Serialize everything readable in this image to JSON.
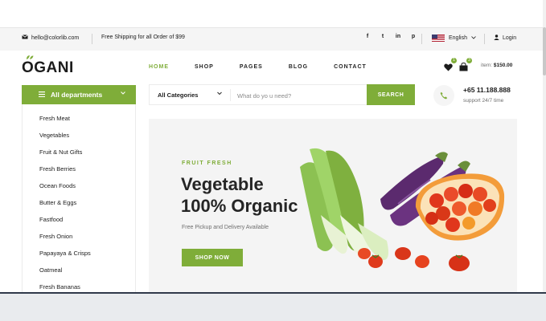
{
  "header_top": {
    "email": "hello@colorlib.com",
    "shipping": "Free Shipping for all Order of $99",
    "socials": [
      "f",
      "t",
      "in",
      "p"
    ],
    "language": "English",
    "login": "Login"
  },
  "logo": "OGANI",
  "nav": [
    "HOME",
    "SHOP",
    "PAGES",
    "BLOG",
    "CONTACT"
  ],
  "cart": {
    "wishlist_count": "1",
    "cart_count": "3",
    "item_label": "item:",
    "total": "$150.00"
  },
  "departments": {
    "title": "All departments",
    "items": [
      "Fresh Meat",
      "Vegetables",
      "Fruit & Nut Gifts",
      "Fresh Berries",
      "Ocean Foods",
      "Butter & Eggs",
      "Fastfood",
      "Fresh Onion",
      "Papayaya & Crisps",
      "Oatmeal",
      "Fresh Bananas"
    ]
  },
  "search": {
    "category": "All Categories",
    "placeholder": "What do yo u need?",
    "button": "SEARCH"
  },
  "phone": {
    "number": "+65 11.188.888",
    "support": "support 24/7 time"
  },
  "hero": {
    "eyebrow": "FRUIT FRESH",
    "title_line1": "Vegetable",
    "title_line2": "100% Organic",
    "subtitle": "Free Pickup and Delivery Available",
    "button": "SHOP NOW"
  },
  "colors": {
    "accent": "#7fad39",
    "text": "#1c1c1c",
    "muted": "#6f6f6f"
  }
}
